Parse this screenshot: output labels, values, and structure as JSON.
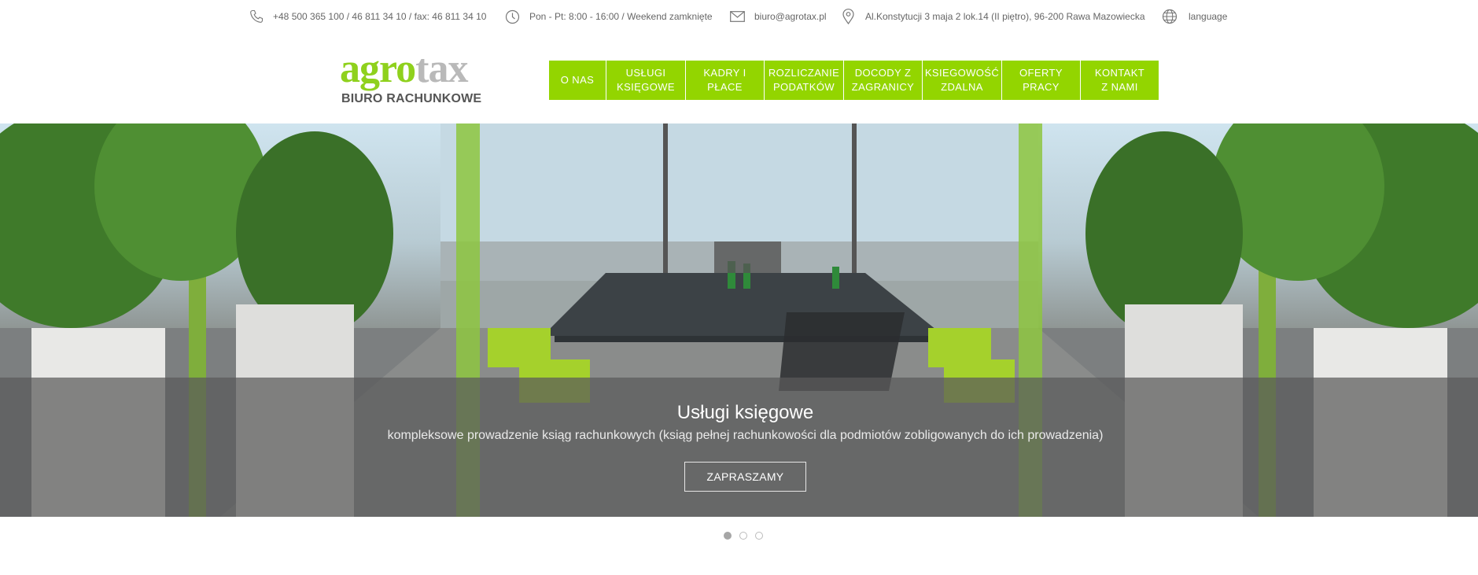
{
  "topbar": {
    "phone": "+48 500 365 100 / 46 811 34 10 / fax: 46 811 34 10",
    "hours": "Pon - Pt: 8:00 - 16:00 / Weekend zamknięte",
    "email": "biuro@agrotax.pl",
    "address": "Al.Konstytucji 3 maja 2 lok.14 (II piętro), 96-200 Rawa Mazowiecka",
    "language": "language",
    "icons": [
      "phone-icon",
      "clock-icon",
      "envelope-icon",
      "map-pin-icon",
      "globe-icon"
    ]
  },
  "logo": {
    "word_part1": "agro",
    "word_part2": "tax",
    "subtitle": "BIURO RACHUNKOWE"
  },
  "colors": {
    "accent": "#93d500",
    "logo_green": "#8fd11d",
    "logo_grey": "#b9b9b9"
  },
  "nav": [
    {
      "label": "O NAS"
    },
    {
      "label": "USŁUGI\nKSIĘGOWE"
    },
    {
      "label": "KADRY I\nPŁACE"
    },
    {
      "label": "ROZLICZANIE\nPODATKÓW"
    },
    {
      "label": "DOCODY Z\nZAGRANICY"
    },
    {
      "label": "KSIEGOWOŚĆ\nZDALNA"
    },
    {
      "label": "OFERTY\nPRACY"
    },
    {
      "label": "KONTAKT\nZ NAMI"
    }
  ],
  "slider": {
    "title": "Usługi księgowe",
    "subtitle": "kompleksowe prowadzenie ksiąg rachunkowych (ksiąg pełnej rachunkowości dla podmiotów zobligowanych do ich prowadzenia)",
    "button": "ZAPRASZAMY",
    "slide_count": 3,
    "active_slide": 1
  }
}
